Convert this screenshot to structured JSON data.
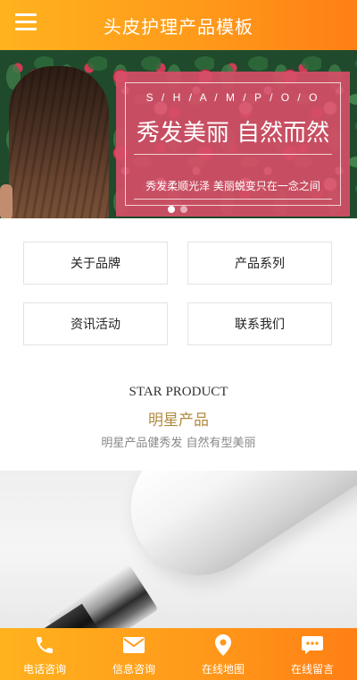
{
  "header": {
    "title": "头皮护理产品模板"
  },
  "banner": {
    "letters": "S / H / A / M / P / O / O",
    "headline": "秀发美丽 自然而然",
    "subline": "秀发柔顺光泽 美丽蜕变只在一念之间",
    "slide_count": 2,
    "active_slide": 1
  },
  "nav": {
    "items": [
      {
        "label": "关于品牌"
      },
      {
        "label": "产品系列"
      },
      {
        "label": "资讯活动"
      },
      {
        "label": "联系我们"
      }
    ]
  },
  "section": {
    "title_en": "STAR PRODUCT",
    "title_cn": "明星产品",
    "description": "明星产品健秀发 自然有型美丽"
  },
  "bottom_bar": {
    "items": [
      {
        "label": "电话咨询",
        "icon": "phone-icon"
      },
      {
        "label": "信息咨询",
        "icon": "mail-icon"
      },
      {
        "label": "在线地图",
        "icon": "map-pin-icon"
      },
      {
        "label": "在线留言",
        "icon": "chat-icon"
      }
    ]
  },
  "colors": {
    "accent": "#ff9a1a",
    "promo_box": "#d64e67",
    "section_title": "#b08a3e"
  }
}
